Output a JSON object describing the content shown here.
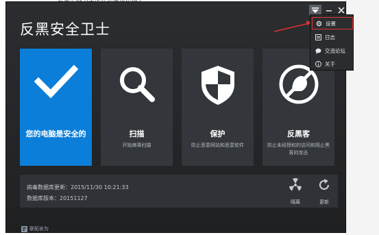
{
  "app": {
    "title": "反黑安全卫士"
  },
  "tiles": [
    {
      "title": "您的电脑是安全的",
      "desc": "",
      "icon": "checkmark-icon"
    },
    {
      "title": "扫描",
      "desc": "开始病毒扫描",
      "icon": "magnifier-icon"
    },
    {
      "title": "保护",
      "desc": "防止恶意网站和恶意软件",
      "icon": "shield-icon"
    },
    {
      "title": "反黑客",
      "desc": "防止未经授权的访问和阻止黑客的攻击",
      "icon": "blocked-hacker-icon"
    }
  ],
  "status": {
    "db_update": "病毒数据库更新：2015/11/30 10:21:33",
    "db_version": "数据库版本：20151127",
    "quarantine_label": "隔离",
    "update_label": "更新"
  },
  "brand": {
    "name": "联拓安为"
  },
  "menu": {
    "items": [
      {
        "label": "设置",
        "icon": "gear-icon"
      },
      {
        "label": "日志",
        "icon": "log-icon"
      },
      {
        "label": "交流论坛",
        "icon": "chat-icon"
      },
      {
        "label": "关于",
        "icon": "info-icon"
      }
    ]
  },
  "colors": {
    "accent": "#0a7ed8",
    "highlight": "#e53030"
  }
}
